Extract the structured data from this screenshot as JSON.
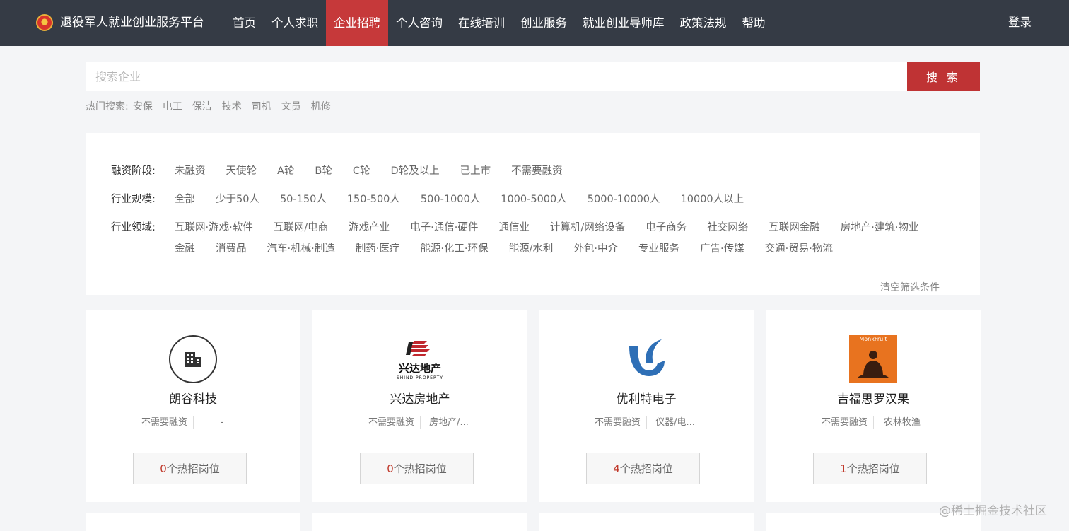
{
  "header": {
    "site_title": "退役军人就业创业服务平台",
    "nav": [
      {
        "label": "首页"
      },
      {
        "label": "个人求职"
      },
      {
        "label": "企业招聘"
      },
      {
        "label": "个人咨询"
      },
      {
        "label": "在线培训"
      },
      {
        "label": "创业服务"
      },
      {
        "label": "就业创业导师库"
      },
      {
        "label": "政策法规"
      },
      {
        "label": "帮助"
      }
    ],
    "active_nav": "企业招聘",
    "login": "登录"
  },
  "search": {
    "placeholder": "搜索企业",
    "button": "搜 索",
    "hot_label": "热门搜索:",
    "hot_items": [
      "安保",
      "电工",
      "保洁",
      "技术",
      "司机",
      "文员",
      "机修"
    ]
  },
  "filters": {
    "funding": {
      "label": "融资阶段:",
      "options": [
        "未融资",
        "天使轮",
        "A轮",
        "B轮",
        "C轮",
        "D轮及以上",
        "已上市",
        "不需要融资"
      ]
    },
    "scale": {
      "label": "行业规模:",
      "options": [
        "全部",
        "少于50人",
        "50-150人",
        "150-500人",
        "500-1000人",
        "1000-5000人",
        "5000-10000人",
        "10000人以上"
      ]
    },
    "industry": {
      "label": "行业领域:",
      "options": [
        "互联网·游戏·软件",
        "互联网/电商",
        "游戏产业",
        "电子·通信·硬件",
        "通信业",
        "计算机/网络设备",
        "电子商务",
        "社交网络",
        "互联网金融",
        "房地产·建筑·物业",
        "金融",
        "消费品",
        "汽车·机械·制造",
        "制药·医疗",
        "能源·化工·环保",
        "能源/水利",
        "外包·中介",
        "专业服务",
        "广告·传媒",
        "交通·贸易·物流"
      ]
    },
    "clear": "清空筛选条件"
  },
  "companies": [
    {
      "name": "朗谷科技",
      "funding": "不需要融资",
      "industry": "-",
      "jobs_count": "0",
      "jobs_suffix": "个热招岗位",
      "logo": "building-icon"
    },
    {
      "name": "兴达房地产",
      "funding": "不需要融资",
      "industry": "房地产/...",
      "jobs_count": "0",
      "jobs_suffix": "个热招岗位",
      "logo": "xingda-logo",
      "logo_text": "兴达地产",
      "logo_subtext": "SHIND PROPERTY"
    },
    {
      "name": "优利特电子",
      "funding": "不需要融资",
      "industry": "仪器/电...",
      "jobs_count": "4",
      "jobs_suffix": "个热招岗位",
      "logo": "youlite-logo"
    },
    {
      "name": "吉福思罗汉果",
      "funding": "不需要融资",
      "industry": "农林牧渔",
      "jobs_count": "1",
      "jobs_suffix": "个热招岗位",
      "logo": "monkfruit-logo",
      "logo_text": "MonkFruit"
    }
  ],
  "watermark": "@稀土掘金技术社区",
  "colors": {
    "topbar": "#353b45",
    "accent": "#bf3334",
    "background": "#f4f5f7"
  }
}
